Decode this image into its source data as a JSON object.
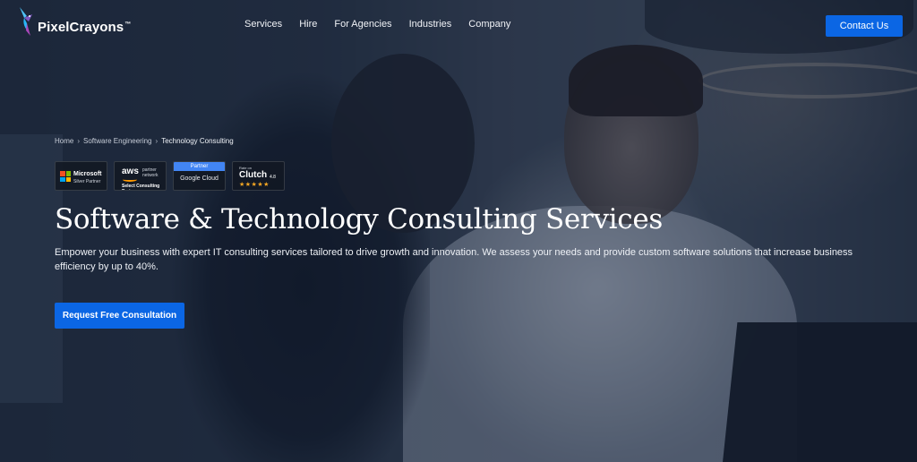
{
  "brand": {
    "name": "PixelCrayons",
    "trademark": "™",
    "accent_color": "#0b66e4"
  },
  "nav": {
    "items": [
      "Services",
      "Hire",
      "For Agencies",
      "Industries",
      "Company"
    ],
    "contact_label": "Contact Us"
  },
  "breadcrumb": {
    "items": [
      "Home",
      "Software Engineering",
      "Technology Consulting"
    ],
    "separator": "›"
  },
  "badges": {
    "microsoft": {
      "title": "Microsoft",
      "subtitle": "Silver Partner"
    },
    "aws": {
      "title": "aws",
      "side_line1": "partner",
      "side_line2": "network",
      "tier": "Select Consulting Partner"
    },
    "google": {
      "tag": "Partner",
      "title": "Google Cloud"
    },
    "clutch": {
      "small": "Rate on",
      "title": "Clutch",
      "rating": "4.8",
      "stars": "★★★★★"
    }
  },
  "hero": {
    "title": "Software & Technology Consulting Services",
    "description": "Empower your business with expert IT consulting services tailored to drive growth and innovation. We assess your needs and provide custom software solutions that increase business efficiency by up to 40%.",
    "cta_label": "Request Free Consultation"
  }
}
